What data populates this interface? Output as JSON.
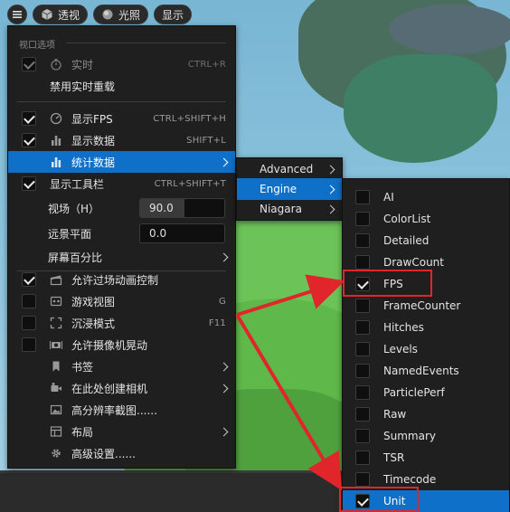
{
  "toolbar": {
    "menu_icon": "hamburger-icon",
    "perspective_label": "透视",
    "lighting_label": "光照",
    "show_label": "显示"
  },
  "viewport_menu": {
    "section_title": "视口选项",
    "items": [
      {
        "label": "实时",
        "shortcut": "CTRL+R",
        "checked": true,
        "disabled": true,
        "icon": "clock-icon"
      },
      {
        "label": "禁用实时重载"
      },
      {
        "label": "显示FPS",
        "shortcut": "CTRL+SHIFT+H",
        "checked": true,
        "icon": "gauge-icon"
      },
      {
        "label": "显示数据",
        "shortcut": "SHIFT+L",
        "checked": true,
        "icon": "bar-chart-icon"
      },
      {
        "label": "统计数据",
        "submenu": true,
        "highlighted": true,
        "icon": "bar-chart-icon"
      },
      {
        "label": "显示工具栏",
        "shortcut": "CTRL+SHIFT+T",
        "checked": true
      },
      {
        "label": "视场（H）",
        "value": "90.0",
        "fill_fraction": 0.53
      },
      {
        "label": "远景平面",
        "value": "0.0"
      },
      {
        "label": "屏幕百分比",
        "submenu": true
      },
      {
        "label": "允许过场动画控制",
        "checked": true,
        "icon": "clapper-icon"
      },
      {
        "label": "游戏视图",
        "shortcut": "G",
        "checked": false,
        "icon": "gamepad-icon"
      },
      {
        "label": "沉浸模式",
        "shortcut": "F11",
        "checked": false,
        "icon": "fullscreen-icon"
      },
      {
        "label": "允许摄像机晃动",
        "checked": false,
        "icon": "camera-shake-icon"
      },
      {
        "label": "书签",
        "submenu": true,
        "icon": "bookmark-icon"
      },
      {
        "label": "在此处创建相机",
        "submenu": true,
        "icon": "camera-icon"
      },
      {
        "label": "高分辨率截图......",
        "icon": "screenshot-icon"
      },
      {
        "label": "布局",
        "submenu": true,
        "icon": "layout-icon"
      },
      {
        "label": "高级设置......",
        "icon": "gear-icon"
      }
    ]
  },
  "stats_menu": {
    "items": [
      {
        "label": "Advanced"
      },
      {
        "label": "Engine",
        "highlighted": true
      },
      {
        "label": "Niagara"
      }
    ]
  },
  "engine_menu": {
    "items": [
      {
        "label": "AI",
        "checked": false
      },
      {
        "label": "ColorList",
        "checked": false
      },
      {
        "label": "Detailed",
        "checked": false
      },
      {
        "label": "DrawCount",
        "checked": false
      },
      {
        "label": "FPS",
        "checked": true,
        "boxed": true
      },
      {
        "label": "FrameCounter",
        "checked": false
      },
      {
        "label": "Hitches",
        "checked": false
      },
      {
        "label": "Levels",
        "checked": false
      },
      {
        "label": "NamedEvents",
        "checked": false
      },
      {
        "label": "ParticlePerf",
        "checked": false
      },
      {
        "label": "Raw",
        "checked": false
      },
      {
        "label": "Summary",
        "checked": false
      },
      {
        "label": "TSR",
        "checked": false
      },
      {
        "label": "Timecode",
        "checked": false
      },
      {
        "label": "Unit",
        "checked": true,
        "highlighted": true,
        "boxed": true
      }
    ]
  },
  "colors": {
    "highlight": "#0e70c8",
    "annotation": "#e0262b",
    "menu_bg": "#1f1f1f"
  }
}
